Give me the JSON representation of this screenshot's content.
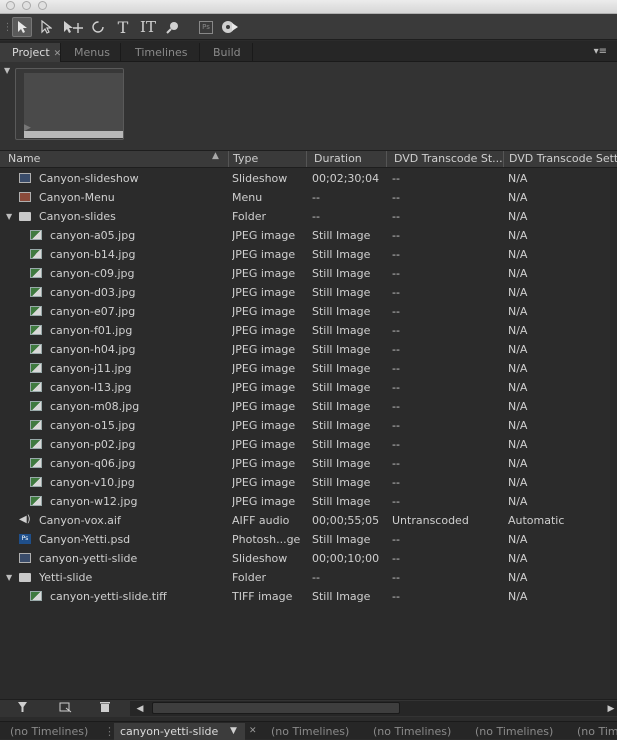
{
  "panel_tabs": [
    {
      "label": "Project",
      "active": true
    },
    {
      "label": "Menus",
      "active": false
    },
    {
      "label": "Timelines",
      "active": false
    },
    {
      "label": "Build",
      "active": false
    }
  ],
  "toolbar": {
    "icons": [
      "selection-arrow-icon",
      "direct-select-icon",
      "move-icon",
      "rotate-icon",
      "text-icon",
      "vertical-text-icon",
      "zoom-icon",
      "photoshop-icon",
      "preview-icon"
    ],
    "text_tool_glyph": "T",
    "vtext_tool_glyph": "IT",
    "ps_glyph": "Ps"
  },
  "columns": [
    "Name",
    "Type",
    "Duration",
    "DVD Transcode St...",
    "DVD Transcode Setti"
  ],
  "rows": [
    {
      "icon": "slideshow",
      "indent": 0,
      "name": "Canyon-slideshow",
      "type": "Slideshow",
      "duration": "00;02;30;04",
      "status": "--",
      "setting": "N/A"
    },
    {
      "icon": "menu",
      "indent": 0,
      "name": "Canyon-Menu",
      "type": "Menu",
      "duration": "--",
      "status": "--",
      "setting": "N/A"
    },
    {
      "icon": "folder",
      "indent": 0,
      "disclose": true,
      "name": "Canyon-slides",
      "type": "Folder",
      "duration": "--",
      "status": "--",
      "setting": "N/A"
    },
    {
      "icon": "image",
      "indent": 1,
      "name": "canyon-a05.jpg",
      "type": "JPEG image",
      "duration": "Still Image",
      "status": "--",
      "setting": "N/A"
    },
    {
      "icon": "image",
      "indent": 1,
      "name": "canyon-b14.jpg",
      "type": "JPEG image",
      "duration": "Still Image",
      "status": "--",
      "setting": "N/A"
    },
    {
      "icon": "image",
      "indent": 1,
      "name": "canyon-c09.jpg",
      "type": "JPEG image",
      "duration": "Still Image",
      "status": "--",
      "setting": "N/A"
    },
    {
      "icon": "image",
      "indent": 1,
      "name": "canyon-d03.jpg",
      "type": "JPEG image",
      "duration": "Still Image",
      "status": "--",
      "setting": "N/A"
    },
    {
      "icon": "image",
      "indent": 1,
      "name": "canyon-e07.jpg",
      "type": "JPEG image",
      "duration": "Still Image",
      "status": "--",
      "setting": "N/A"
    },
    {
      "icon": "image",
      "indent": 1,
      "name": "canyon-f01.jpg",
      "type": "JPEG image",
      "duration": "Still Image",
      "status": "--",
      "setting": "N/A"
    },
    {
      "icon": "image",
      "indent": 1,
      "name": "canyon-h04.jpg",
      "type": "JPEG image",
      "duration": "Still Image",
      "status": "--",
      "setting": "N/A"
    },
    {
      "icon": "image",
      "indent": 1,
      "name": "canyon-j11.jpg",
      "type": "JPEG image",
      "duration": "Still Image",
      "status": "--",
      "setting": "N/A"
    },
    {
      "icon": "image",
      "indent": 1,
      "name": "canyon-l13.jpg",
      "type": "JPEG image",
      "duration": "Still Image",
      "status": "--",
      "setting": "N/A"
    },
    {
      "icon": "image",
      "indent": 1,
      "name": "canyon-m08.jpg",
      "type": "JPEG image",
      "duration": "Still Image",
      "status": "--",
      "setting": "N/A"
    },
    {
      "icon": "image",
      "indent": 1,
      "name": "canyon-o15.jpg",
      "type": "JPEG image",
      "duration": "Still Image",
      "status": "--",
      "setting": "N/A"
    },
    {
      "icon": "image",
      "indent": 1,
      "name": "canyon-p02.jpg",
      "type": "JPEG image",
      "duration": "Still Image",
      "status": "--",
      "setting": "N/A"
    },
    {
      "icon": "image",
      "indent": 1,
      "name": "canyon-q06.jpg",
      "type": "JPEG image",
      "duration": "Still Image",
      "status": "--",
      "setting": "N/A"
    },
    {
      "icon": "image",
      "indent": 1,
      "name": "canyon-v10.jpg",
      "type": "JPEG image",
      "duration": "Still Image",
      "status": "--",
      "setting": "N/A"
    },
    {
      "icon": "image",
      "indent": 1,
      "name": "canyon-w12.jpg",
      "type": "JPEG image",
      "duration": "Still Image",
      "status": "--",
      "setting": "N/A"
    },
    {
      "icon": "audio",
      "indent": 0,
      "name": "Canyon-vox.aif",
      "type": "AIFF audio",
      "duration": "00;00;55;05",
      "status": "Untranscoded",
      "setting": "Automatic"
    },
    {
      "icon": "psd",
      "indent": 0,
      "name": "Canyon-Yetti.psd",
      "type": "Photosh...ge",
      "duration": "Still Image",
      "status": "--",
      "setting": "N/A"
    },
    {
      "icon": "slideshow",
      "indent": 0,
      "name": "canyon-yetti-slide",
      "type": "Slideshow",
      "duration": "00;00;10;00",
      "status": "--",
      "setting": "N/A"
    },
    {
      "icon": "folder",
      "indent": 0,
      "disclose": true,
      "name": "Yetti-slide",
      "type": "Folder",
      "duration": "--",
      "status": "--",
      "setting": "N/A"
    },
    {
      "icon": "image",
      "indent": 1,
      "name": "canyon-yetti-slide.tiff",
      "type": "TIFF image",
      "duration": "Still Image",
      "status": "--",
      "setting": "N/A"
    }
  ],
  "bottom_icons": [
    "filter-icon",
    "new-item-icon",
    "trash-icon"
  ],
  "timeline_tabs": [
    {
      "label": "(no Timelines)",
      "active": false
    },
    {
      "label": "canyon-yetti-slide",
      "active": true
    },
    {
      "label": "(no Timelines)",
      "active": false
    },
    {
      "label": "(no Timelines)",
      "active": false
    },
    {
      "label": "(no Timelines)",
      "active": false
    },
    {
      "label": "(no Tim",
      "active": false
    }
  ],
  "colors": {
    "background": "#2b2b2b",
    "header": "#3a3a3a",
    "text": "#cfcfcf"
  }
}
